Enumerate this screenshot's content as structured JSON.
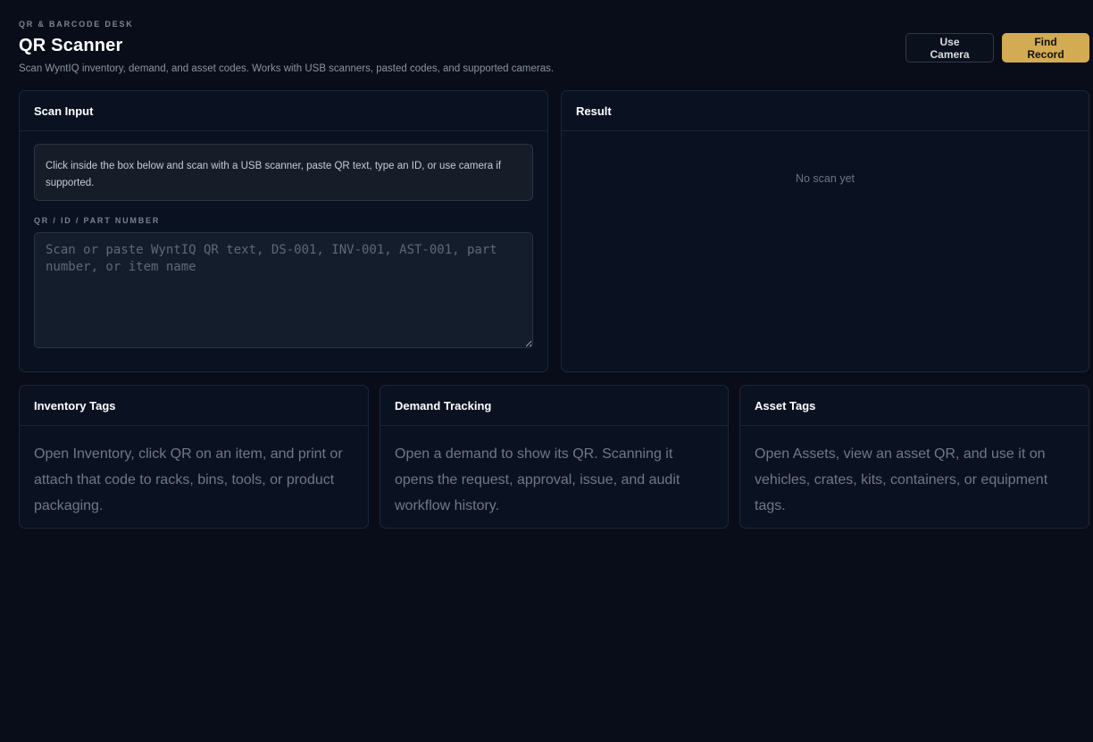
{
  "header": {
    "eyebrow": "QR & BARCODE DESK",
    "title": "QR Scanner",
    "subtitle": "Scan WyntIQ inventory, demand, and asset codes. Works with USB scanners, pasted codes, and supported cameras.",
    "camera_button": "Use Camera",
    "find_button": "Find Record"
  },
  "scan_input": {
    "title": "Scan Input",
    "hint": "Click inside the box below and scan with a USB scanner, paste QR text, type an ID, or use camera if supported.",
    "field_label": "QR / ID / PART NUMBER",
    "placeholder": "Scan or paste WyntIQ QR text, DS-001, INV-001, AST-001, part number, or item name",
    "value": ""
  },
  "result": {
    "title": "Result",
    "empty": "No scan yet"
  },
  "cards": [
    {
      "title": "Inventory Tags",
      "body": "Open Inventory, click QR on an item, and print or attach that code to racks, bins, tools, or product packaging."
    },
    {
      "title": "Demand Tracking",
      "body": "Open a demand to show its QR. Scanning it opens the request, approval, issue, and audit workflow history."
    },
    {
      "title": "Asset Tags",
      "body": "Open Assets, view an asset QR, and use it on vehicles, crates, kits, containers, or equipment tags."
    }
  ],
  "colors": {
    "background": "#080d19",
    "panel": "#0a1222",
    "accent": "#d2ab52"
  }
}
